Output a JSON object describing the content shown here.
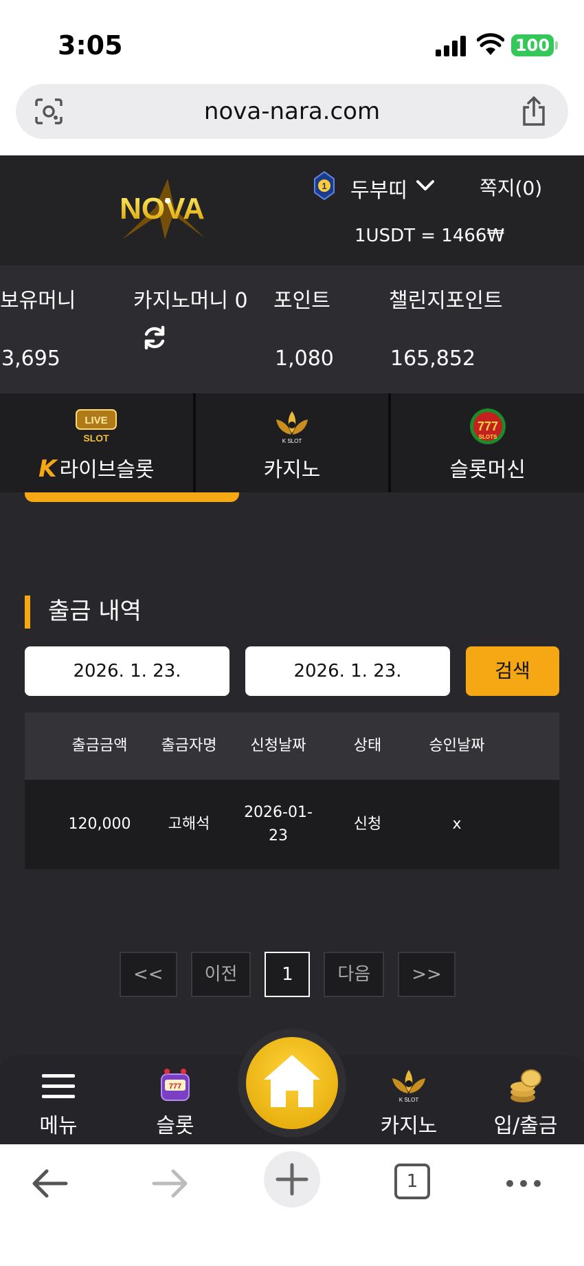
{
  "status": {
    "time": "3:05",
    "battery": "100"
  },
  "browser": {
    "url": "nova-nara.com",
    "tab_count": "1"
  },
  "header": {
    "logo_text": "NOVA",
    "username": "두부띠",
    "messages": "쪽지(0)",
    "rate": "1USDT = 1466₩",
    "rank": "1"
  },
  "balances": {
    "held_label": "보유머니",
    "held_value": "3,695",
    "casino_label": "카지노머니 0",
    "point_label": "포인트",
    "point_value": "1,080",
    "challenge_label": "챌린지포인트",
    "challenge_value": "165,852"
  },
  "tabs": [
    {
      "label": "라이브슬롯",
      "prefix": "K",
      "icon": "live-slot-icon"
    },
    {
      "label": "카지노",
      "icon": "k-slot-lotus-icon"
    },
    {
      "label": "슬롯머신",
      "icon": "777-slots-icon"
    }
  ],
  "withdraw": {
    "title": "출금 내역",
    "start_date": "2026. 1. 23.",
    "end_date": "2026. 1. 23.",
    "search_label": "검색",
    "columns": [
      "출금금액",
      "출금자명",
      "신청날짜",
      "상태",
      "승인날짜"
    ],
    "rows": [
      {
        "amount": "120,000",
        "name": "고해석",
        "date_line1": "2026-01-",
        "date_line2": "23",
        "status": "신청",
        "approved": "x"
      }
    ]
  },
  "pager": {
    "first": "<<",
    "prev": "이전",
    "current": "1",
    "next": "다음",
    "last": ">>"
  },
  "bottomnav": {
    "menu": "메뉴",
    "slot": "슬롯",
    "casino": "카지노",
    "deposit": "입/출금"
  },
  "colors": {
    "accent": "#f5a814",
    "background": "#28272b",
    "header": "#232326"
  }
}
